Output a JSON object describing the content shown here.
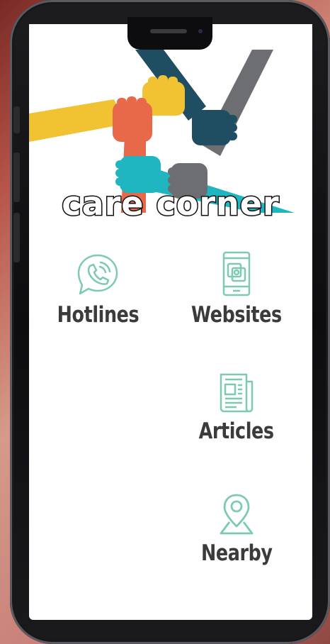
{
  "app": {
    "title": "care corner"
  },
  "menu": {
    "hotlines": {
      "label": "Hotlines",
      "icon": "phone-call-icon"
    },
    "websites": {
      "label": "Websites",
      "icon": "mobile-website-icon"
    },
    "articles": {
      "label": "Articles",
      "icon": "newspaper-icon"
    },
    "nearby": {
      "label": "Nearby",
      "icon": "location-pin-icon"
    }
  },
  "colors": {
    "icon_accent": "#7ccbb0",
    "label_text": "#3b3b3b",
    "hero_yellow": "#f1c232",
    "hero_orange": "#e8684a",
    "hero_navy": "#1f4e63",
    "hero_gray": "#6d6e71",
    "hero_teal": "#1fb6c1"
  }
}
